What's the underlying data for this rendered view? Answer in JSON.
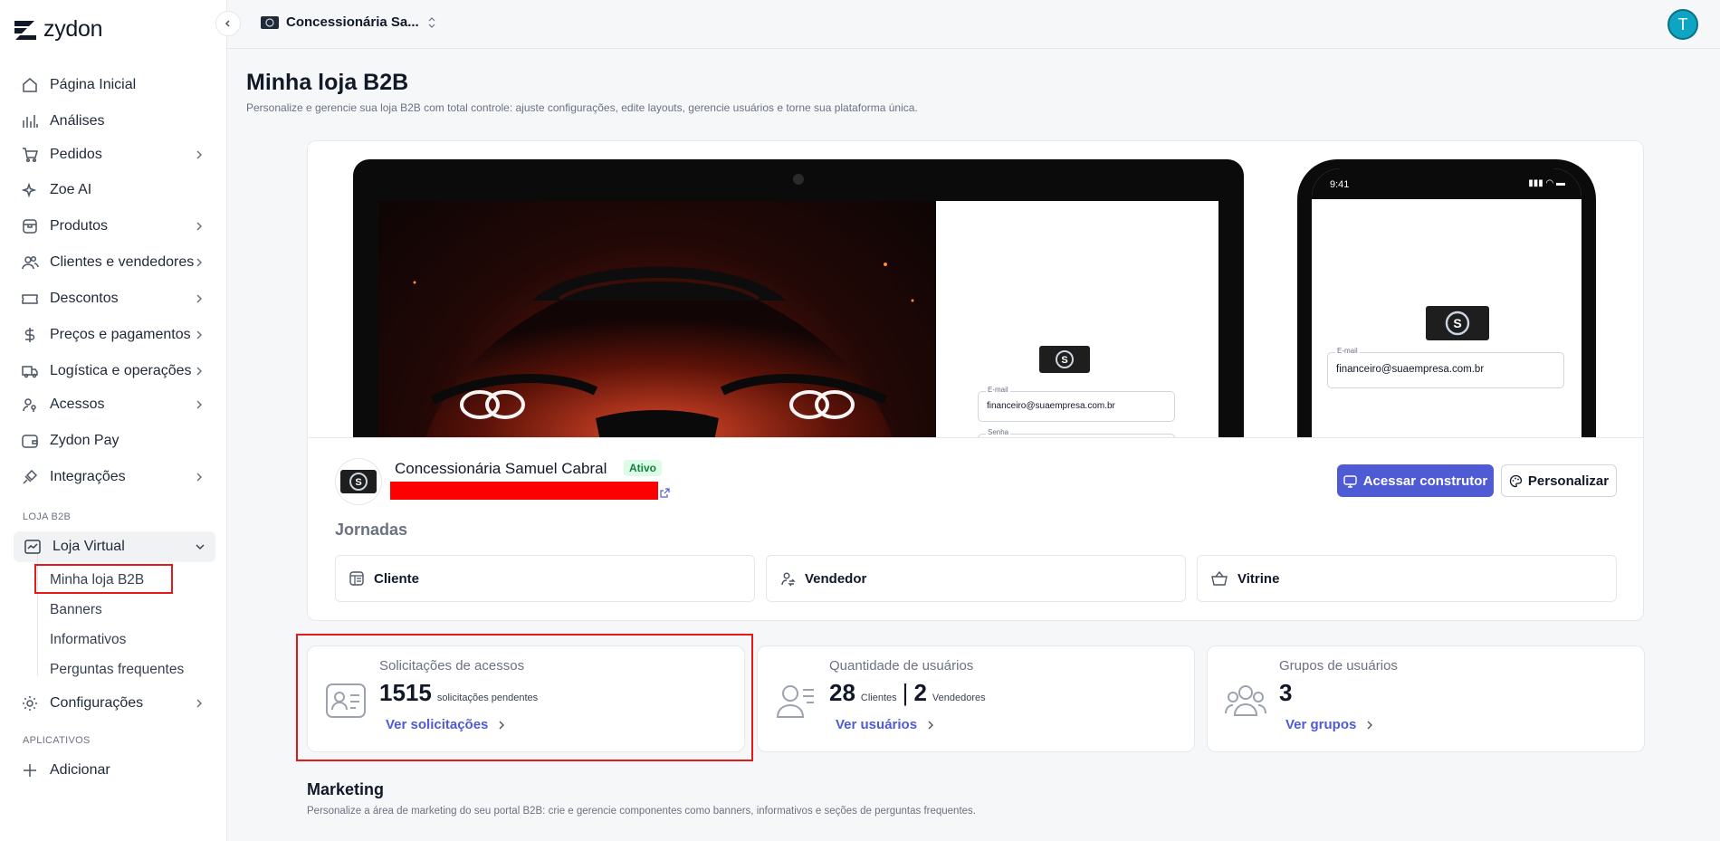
{
  "brand": {
    "name": "zydon",
    "icon": "zydon-logo-icon"
  },
  "topbar": {
    "store_name": "Concessionária Sa...",
    "avatar_initial": "T"
  },
  "sidebar": {
    "items": [
      {
        "label": "Página Inicial",
        "icon": "home-icon"
      },
      {
        "label": "Análises",
        "icon": "bar-chart-icon"
      },
      {
        "label": "Pedidos",
        "icon": "cart-icon"
      },
      {
        "label": "Zoe AI",
        "icon": "sparkle-icon"
      },
      {
        "label": "Produtos",
        "icon": "box-icon"
      },
      {
        "label": "Clientes e vendedores",
        "icon": "users-icon"
      },
      {
        "label": "Descontos",
        "icon": "ticket-icon"
      },
      {
        "label": "Preços e pagamentos",
        "icon": "dollar-icon"
      },
      {
        "label": "Logística e operações",
        "icon": "truck-icon"
      },
      {
        "label": "Acessos",
        "icon": "user-key-icon"
      },
      {
        "label": "Zydon Pay",
        "icon": "wallet-icon"
      },
      {
        "label": "Integrações",
        "icon": "plug-icon"
      }
    ],
    "section_b2b": "LOJA B2B",
    "loja_virtual": "Loja Virtual",
    "sub_items": [
      "Minha loja B2B",
      "Banners",
      "Informativos",
      "Perguntas frequentes"
    ],
    "configuracoes": "Configurações",
    "section_apps": "APLICATIVOS",
    "add_label": "Adicionar"
  },
  "page": {
    "title": "Minha loja B2B",
    "subtitle": "Personalize e gerencie sua loja B2B com total controle: ajuste configurações, edite layouts, gerencie usuários e torne sua plataforma única."
  },
  "preview": {
    "email_label": "E-mail",
    "email_value": "financeiro@suaempresa.com.br",
    "password_label": "Senha",
    "phone_time": "9:41"
  },
  "store": {
    "name": "Concessionária Samuel Cabral",
    "status": "Ativo",
    "btn_builder": "Acessar construtor",
    "btn_customize": "Personalizar"
  },
  "jornadas": {
    "title": "Jornadas",
    "items": [
      "Cliente",
      "Vendedor",
      "Vitrine"
    ]
  },
  "stats": {
    "access": {
      "label": "Solicitações de acessos",
      "value": "1515",
      "unit": "solicitações pendentes",
      "link": "Ver solicitações"
    },
    "users": {
      "label": "Quantidade de usuários",
      "clients": "28",
      "clients_unit": "Clientes",
      "sellers": "2",
      "sellers_unit": "Vendedores",
      "separator": "|",
      "link": "Ver usuários"
    },
    "groups": {
      "label": "Grupos de usuários",
      "value": "3",
      "link": "Ver grupos"
    }
  },
  "marketing": {
    "title": "Marketing",
    "subtitle": "Personalize a área de marketing do seu portal B2B: crie e gerencie componentes como banners, informativos e seções de perguntas frequentes."
  },
  "colors": {
    "accent": "#4f5bd5",
    "highlight": "#e41a1a",
    "active_badge_bg": "#dcfce7",
    "active_badge_text": "#15803d"
  }
}
